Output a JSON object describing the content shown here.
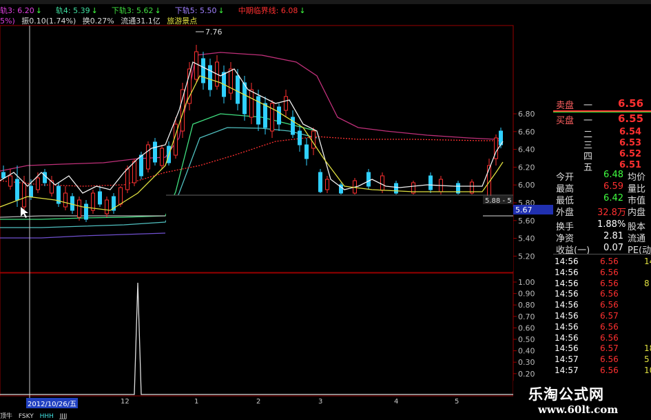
{
  "indicator_line1": [
    {
      "label": "轨3: 6.20",
      "color": "#e040e0",
      "arrow": "↓"
    },
    {
      "label": "轨4: 5.39",
      "color": "#40e0a0",
      "arrow": "↓"
    },
    {
      "label": "下轨3: 5.62",
      "color": "#40e040",
      "arrow": "↓"
    },
    {
      "label": "下轨5: 5.50",
      "color": "#a080ff",
      "arrow": "↓"
    },
    {
      "label": "中期临界线: 6.08",
      "color": "#ff3030",
      "arrow": "↓"
    }
  ],
  "indicator_line2": {
    "prefix": "5%)",
    "amplitude": "振0.10(1.74%)",
    "turnover": "换0.27%",
    "float": "流通31.1亿",
    "concept": "旅游景点"
  },
  "price_axis": [
    "6.80",
    "6.60",
    "6.40",
    "6.20",
    "6.00",
    "5.80",
    "5.60",
    "5.40",
    "5.20"
  ],
  "volume_axis": [
    "1.00",
    "0.90",
    "0.80",
    "0.70",
    "0.60",
    "0.50",
    "0.40",
    "0.30",
    "0.20",
    "0.10"
  ],
  "chart_annotations": {
    "high_marker": "7.76",
    "cursor_price_left": "5.88 - 5",
    "cursor_price_box": "5.67"
  },
  "x_axis": {
    "date_tag": "2012/10/26/五",
    "months": [
      "12",
      "1",
      "2",
      "3",
      "4",
      "5"
    ]
  },
  "bottom_tabs": [
    "顶牛",
    "FSKY",
    "HHH",
    "JJJJ"
  ],
  "quote_panel": {
    "ask_label": "卖盘",
    "ask_level": "一",
    "ask_price": "6.56",
    "bid_label": "买盘",
    "bid_level": "一",
    "bid_price": "6.55",
    "levels": [
      {
        "level": "二",
        "price": "6.54"
      },
      {
        "level": "三",
        "price": "6.53"
      },
      {
        "level": "四",
        "price": "6.52"
      },
      {
        "level": "五",
        "price": "6.51"
      }
    ],
    "stats": [
      {
        "label": "今开",
        "value": "6.48",
        "extra": "均价"
      },
      {
        "label": "最高",
        "value": "6.59",
        "extra": "量比"
      },
      {
        "label": "最低",
        "value": "6.42",
        "extra": "市值"
      },
      {
        "label": "外盘",
        "value": "32.8万",
        "extra": "内盘"
      },
      {
        "label": "换手",
        "value": "1.88%",
        "extra": "股本"
      },
      {
        "label": "净资",
        "value": "2.81",
        "extra": "流通"
      },
      {
        "label": "收益(一)",
        "value": "0.07",
        "extra": "PE(动"
      }
    ],
    "ticks": [
      {
        "time": "14:56",
        "price": "6.56",
        "vol": "14"
      },
      {
        "time": "14:56",
        "price": "6.56",
        "vol": ""
      },
      {
        "time": "14:56",
        "price": "6.56",
        "vol": "8"
      },
      {
        "time": "14:56",
        "price": "6.56",
        "vol": ""
      },
      {
        "time": "14:56",
        "price": "6.56",
        "vol": ""
      },
      {
        "time": "14:56",
        "price": "6.57",
        "vol": ""
      },
      {
        "time": "14:56",
        "price": "6.56",
        "vol": ""
      },
      {
        "time": "14:56",
        "price": "6.56",
        "vol": ""
      },
      {
        "time": "14:56",
        "price": "6.57",
        "vol": "18"
      },
      {
        "time": "14:57",
        "price": "6.56",
        "vol": "5"
      },
      {
        "time": "14:57",
        "price": "6.56",
        "vol": "10"
      }
    ]
  },
  "watermark": {
    "title": "乐淘公式网",
    "url": "www.60lt.com"
  },
  "colors": {
    "up": "#ff3030",
    "down": "#30d0ff",
    "label": "#dddddd",
    "value_white": "#ffffff",
    "value_green": "#40ff40"
  }
}
